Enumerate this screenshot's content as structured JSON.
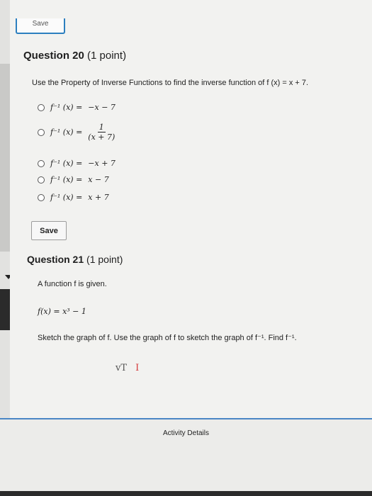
{
  "top_save_label": "Save",
  "q20": {
    "title": "Question 20",
    "points": "(1 point)",
    "prompt": "Use the Property of Inverse Functions to find the inverse function of f (x) = x + 7.",
    "options": [
      {
        "lhs": "f⁻¹ (x) =",
        "rhs": "−x − 7"
      },
      {
        "lhs": "f⁻¹ (x) =",
        "num": "1",
        "den": "(x + 7)"
      },
      {
        "lhs": "f⁻¹ (x) =",
        "rhs": "−x + 7"
      },
      {
        "lhs": "f⁻¹ (x) =",
        "rhs": "x − 7"
      },
      {
        "lhs": "f⁻¹ (x) =",
        "rhs": "x + 7"
      }
    ],
    "save_label": "Save"
  },
  "q21": {
    "title": "Question 21",
    "points": "(1 point)",
    "intro": "A function f is given.",
    "function": "f(x) = x³ − 1",
    "instruction": "Sketch the graph of f. Use the graph of f to sketch the graph of f⁻¹. Find f⁻¹.",
    "marks_left": "vT",
    "marks_right": "I"
  },
  "footer": {
    "activity_label": "Activity Details"
  },
  "colors": {
    "accent": "#2c7fbf",
    "footer_line": "#4a86c5",
    "red_mark": "#d43b3b"
  }
}
